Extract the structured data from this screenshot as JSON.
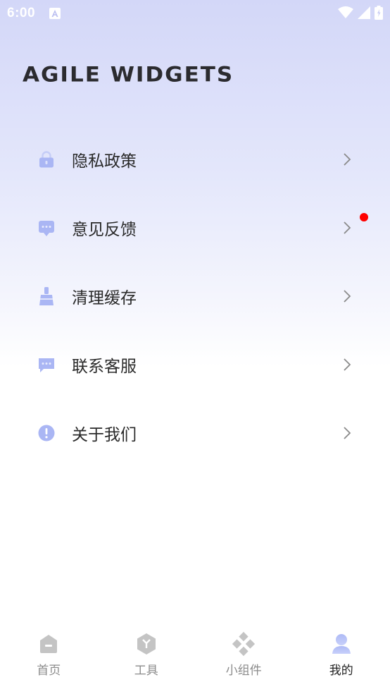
{
  "status_bar": {
    "time": "6:00",
    "icons": [
      "a-notification-icon",
      "wifi-icon",
      "signal-icon",
      "battery-icon"
    ]
  },
  "header": {
    "title": "AGILE WIDGETS"
  },
  "menu": {
    "items": [
      {
        "label": "隐私政策",
        "icon": "lock-icon"
      },
      {
        "label": "意见反馈",
        "icon": "feedback-icon",
        "badge": true
      },
      {
        "label": "清理缓存",
        "icon": "broom-icon"
      },
      {
        "label": "联系客服",
        "icon": "chat-icon"
      },
      {
        "label": "关于我们",
        "icon": "info-icon"
      }
    ]
  },
  "bottom_nav": {
    "tabs": [
      {
        "label": "首页",
        "icon": "home-icon"
      },
      {
        "label": "工具",
        "icon": "tools-icon"
      },
      {
        "label": "小组件",
        "icon": "widgets-icon"
      },
      {
        "label": "我的",
        "icon": "profile-icon",
        "active": true
      }
    ]
  },
  "colors": {
    "accent": "#aab6f4",
    "badge": "#ff0000",
    "inactive_icon": "#c4c4c4"
  }
}
